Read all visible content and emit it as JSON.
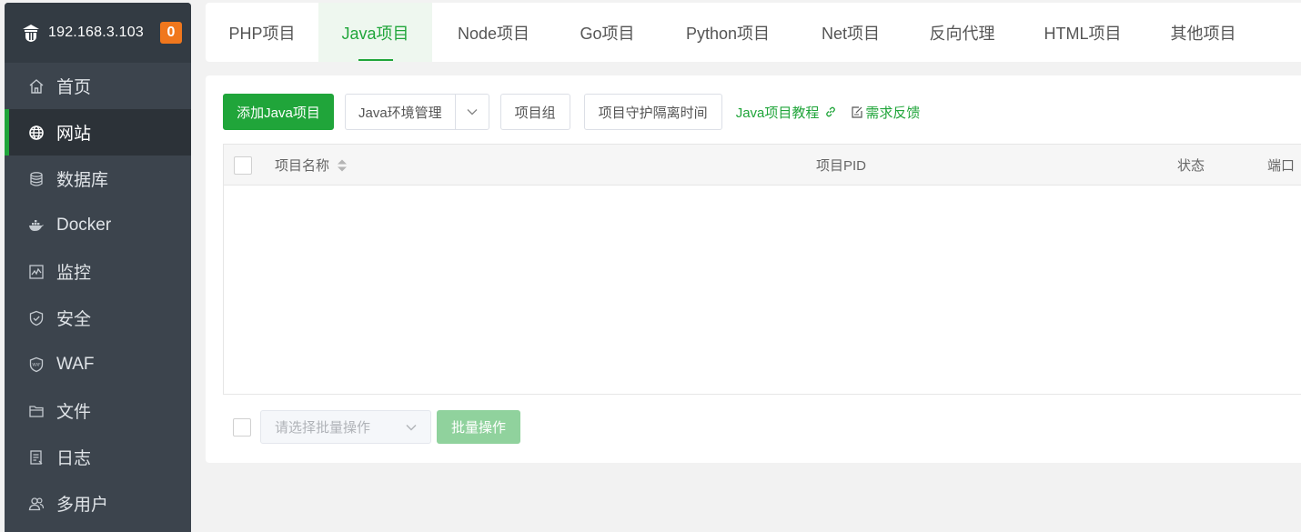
{
  "sidebar": {
    "server_ip": "192.168.3.103",
    "badge_count": "0",
    "items": [
      {
        "label": "首页",
        "icon": "home-icon"
      },
      {
        "label": "网站",
        "icon": "globe-icon",
        "active": true
      },
      {
        "label": "数据库",
        "icon": "database-icon"
      },
      {
        "label": "Docker",
        "icon": "docker-icon"
      },
      {
        "label": "监控",
        "icon": "monitor-icon"
      },
      {
        "label": "安全",
        "icon": "shield-icon"
      },
      {
        "label": "WAF",
        "icon": "waf-shield-icon"
      },
      {
        "label": "文件",
        "icon": "folder-icon"
      },
      {
        "label": "日志",
        "icon": "log-icon"
      },
      {
        "label": "多用户",
        "icon": "users-icon"
      }
    ]
  },
  "tabs": [
    {
      "label": "PHP项目"
    },
    {
      "label": "Java项目",
      "active": true
    },
    {
      "label": "Node项目"
    },
    {
      "label": "Go项目"
    },
    {
      "label": "Python项目"
    },
    {
      "label": "Net项目"
    },
    {
      "label": "反向代理"
    },
    {
      "label": "HTML项目"
    },
    {
      "label": "其他项目"
    }
  ],
  "toolbar": {
    "add_label": "添加Java项目",
    "env_label": "Java环境管理",
    "group_label": "项目组",
    "guard_label": "项目守护隔离时间",
    "tutorial_label": "Java项目教程",
    "feedback_label": "需求反馈"
  },
  "table": {
    "columns": [
      "项目名称",
      "项目PID",
      "状态",
      "端口"
    ]
  },
  "footer": {
    "batch_placeholder": "请选择批量操作",
    "batch_button": "批量操作"
  },
  "colors": {
    "accent": "#20a53a",
    "sidebar_bg": "#3c444d",
    "badge": "#f0771d"
  }
}
